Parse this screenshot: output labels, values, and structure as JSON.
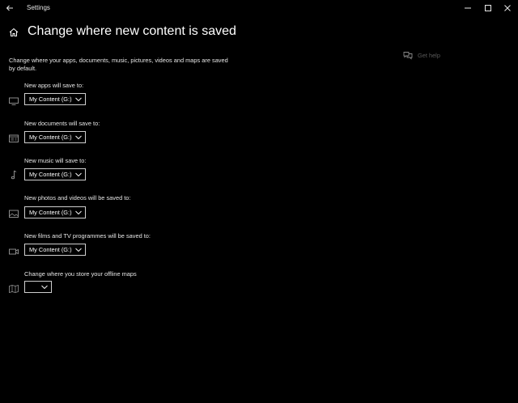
{
  "window": {
    "title": "Settings"
  },
  "page": {
    "title": "Change where new content is saved",
    "intro": "Change where your apps, documents, music, pictures, videos and maps are saved by default.",
    "help_label": "Get help"
  },
  "sections": [
    {
      "icon": "monitor-icon",
      "label": "New apps will save to:",
      "value": "My Content (G:)"
    },
    {
      "icon": "documents-icon",
      "label": "New documents will save to:",
      "value": "My Content (G:)"
    },
    {
      "icon": "music-note-icon",
      "label": "New music will save to:",
      "value": "My Content (G:)"
    },
    {
      "icon": "picture-icon",
      "label": "New photos and videos will be saved to:",
      "value": "My Content (G:)"
    },
    {
      "icon": "video-camera-icon",
      "label": "New films and TV programmes will be saved to:",
      "value": "My Content (G:)"
    },
    {
      "icon": "map-icon",
      "label": "Change where you store your offline maps",
      "value": ""
    }
  ],
  "colors": {
    "background": "#000000",
    "text": "#ffffff",
    "muted": "#5a5a5a",
    "border": "#cfcfcf"
  }
}
